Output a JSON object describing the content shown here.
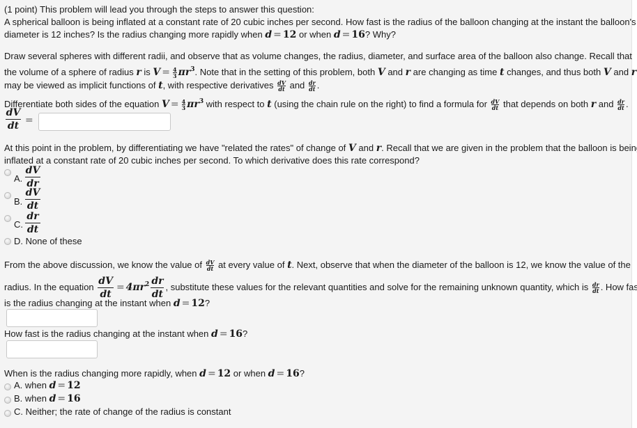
{
  "problem": {
    "intro_lines": [
      "(1 point) This problem will lead you through the steps to answer this question:",
      "A spherical balloon is being inflated at a constant rate of 20 cubic inches per second. How fast is the radius of the balloon changing at the instant the balloon's",
      "diameter is 12 inches? Is the radius changing more rapidly when",
      "or when",
      "? Why?"
    ],
    "d12": "d",
    "eq": "=",
    "val12": "12",
    "val16": "16"
  },
  "part1": {
    "line1": "Draw several spheres with different radii, and observe that as volume changes, the radius, diameter, and surface area of the balloon also change. Recall that",
    "line2_a": "the volume of a sphere of radius",
    "line2_b": "is",
    "line2_c": ". Note that in the setting of this problem, both",
    "line2_d": "and",
    "line2_e": "are changing as time",
    "line2_f": "changes, and thus both",
    "line2_g": "and",
    "line3_a": "may be viewed as implicit functions of",
    "line3_b": ", with respective derivatives",
    "line3_c": "and",
    "line3_d": ".",
    "line4_a": "Differentiate both sides of the equation",
    "line4_b": "with respect to",
    "line4_c": "(using the chain rule on the right) to find a formula for",
    "line4_d": "that depends on both",
    "line4_e": "and",
    "line4_f": ".",
    "sym_V": "V",
    "sym_r": "r",
    "sym_t": "t",
    "sym_pi": "π",
    "four": "4",
    "three": "3",
    "cube": "3",
    "dV": "dV",
    "dt": "dt",
    "dr": "dr",
    "answer_value": ""
  },
  "part2": {
    "line1_a": "At this point in the problem, by differentiating we have \"related the rates\" of change of",
    "line1_b": "and",
    "line1_c": ". Recall that we are given in the problem that the balloon is being",
    "line2": "inflated at a constant rate of 20 cubic inches per second. To which derivative does this rate correspond?",
    "options": [
      {
        "letter": "A.",
        "num": "dV",
        "den": "dr"
      },
      {
        "letter": "B.",
        "num": "dV",
        "den": "dt"
      },
      {
        "letter": "C.",
        "num": "dr",
        "den": "dt"
      },
      {
        "letter": "D.",
        "text": "None of these"
      }
    ]
  },
  "part3": {
    "line1_a": "From the above discussion, we know the value of",
    "line1_b": "at every value of",
    "line1_c": ". Next, observe that when the diameter of the balloon is 12, we know the value of the",
    "line2_a": "radius. In the equation",
    "line2_b": "4πr",
    "line2_sq": "2",
    "line2_c": ", substitute these values for the relevant quantities and solve for the remaining unknown quantity, which is",
    "line2_d": ". How fast",
    "line3": "is the radius changing at the instant when",
    "line3_end": "?",
    "answer12_value": "",
    "q16": "How fast is the radius changing at the instant when",
    "q16_end": "?",
    "answer16_value": ""
  },
  "part4": {
    "question_a": "When is the radius changing more rapidly, when",
    "question_b": "or when",
    "question_c": "?",
    "options": [
      {
        "letter": "A.",
        "text": "when",
        "value": "12"
      },
      {
        "letter": "B.",
        "text": "when",
        "value": "16"
      },
      {
        "letter": "C.",
        "text": "Neither; the rate of change of the radius is constant"
      }
    ]
  }
}
